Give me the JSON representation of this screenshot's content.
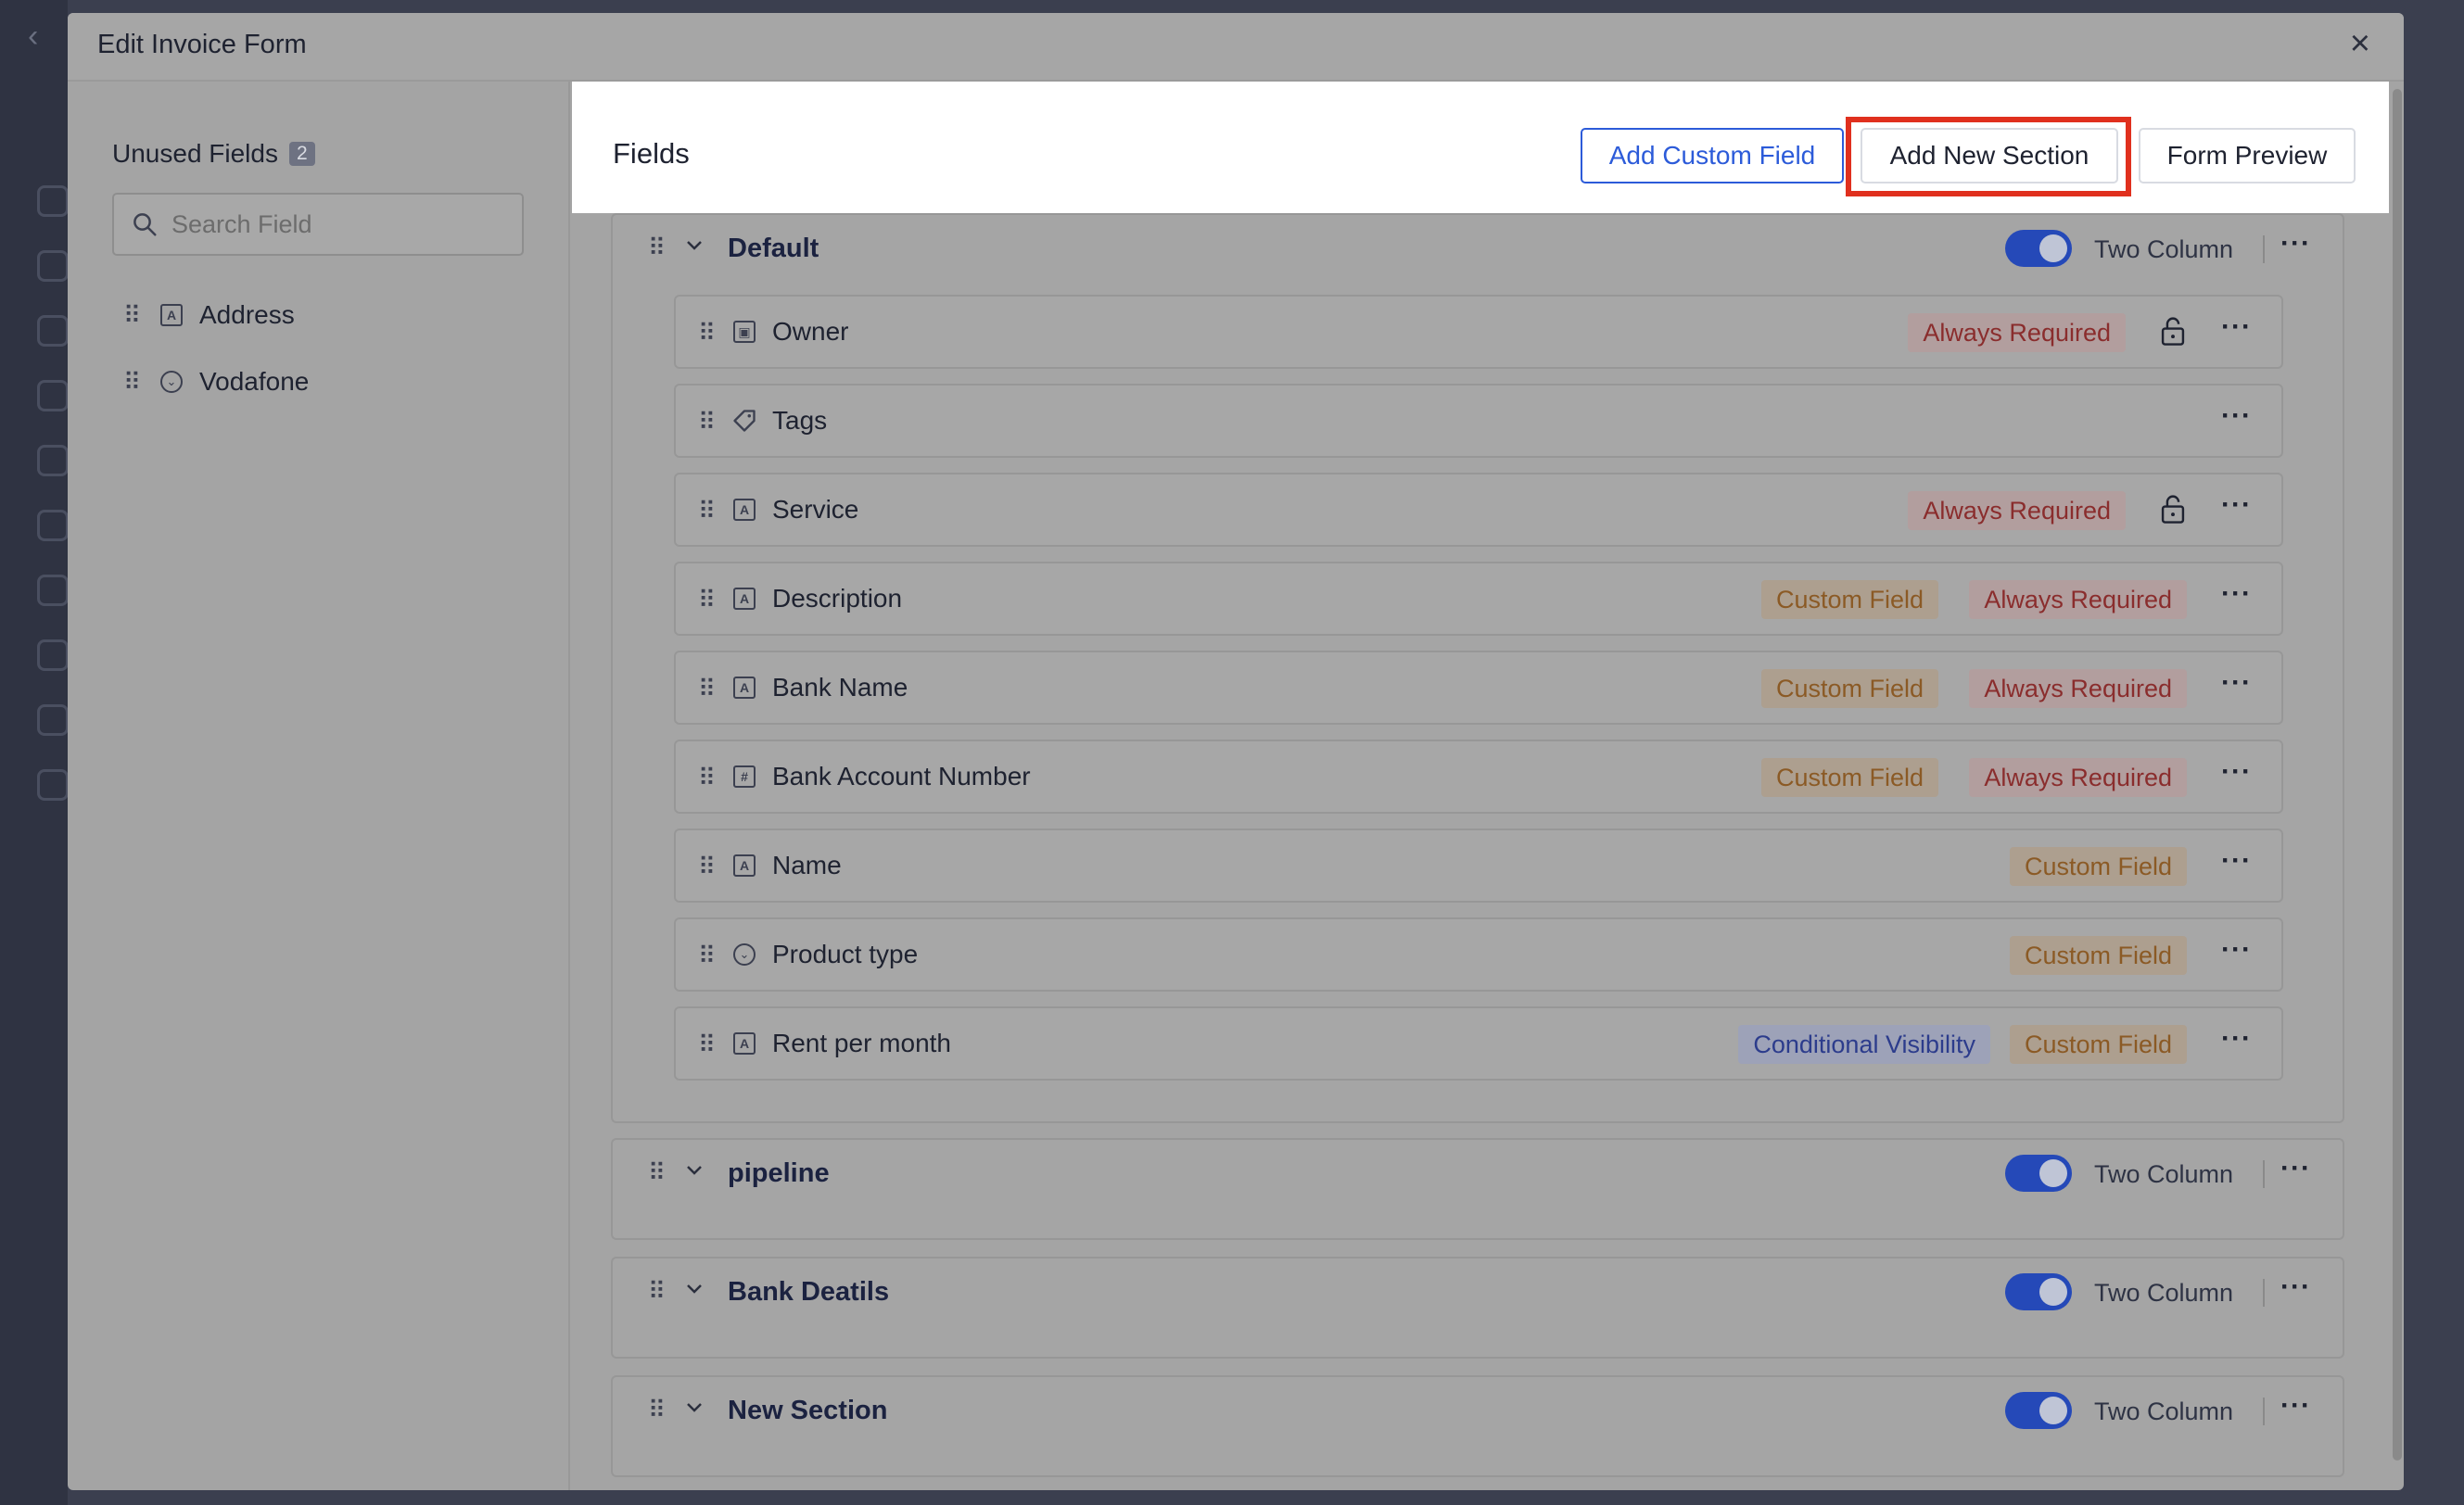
{
  "modal": {
    "title": "Edit Invoice Form",
    "close_icon": "×"
  },
  "unused": {
    "title": "Unused Fields",
    "count": "2",
    "search_placeholder": "Search Field",
    "items": [
      {
        "label": "Address",
        "icon": "text-field-icon"
      },
      {
        "label": "Vodafone",
        "icon": "dropdown-field-icon"
      }
    ]
  },
  "fields_panel": {
    "title": "Fields",
    "add_custom_field": "Add Custom Field",
    "add_new_section": "Add New Section",
    "form_preview": "Form Preview"
  },
  "sections": [
    {
      "title": "Default",
      "toggle_label": "Two Column",
      "toggle_on": true,
      "fields": [
        {
          "label": "Owner",
          "icon": "user-field-icon",
          "badges": [
            "Always Required"
          ],
          "locked": true
        },
        {
          "label": "Tags",
          "icon": "tag-icon",
          "badges": [],
          "locked": false
        },
        {
          "label": "Service",
          "icon": "text-field-icon",
          "badges": [
            "Always Required"
          ],
          "locked": true
        },
        {
          "label": "Description",
          "icon": "text-field-icon",
          "badges": [
            "Custom Field",
            "Always Required"
          ],
          "locked": false
        },
        {
          "label": "Bank Name",
          "icon": "text-field-icon",
          "badges": [
            "Custom Field",
            "Always Required"
          ],
          "locked": false
        },
        {
          "label": "Bank Account Number",
          "icon": "number-field-icon",
          "badges": [
            "Custom Field",
            "Always Required"
          ],
          "locked": false
        },
        {
          "label": "Name",
          "icon": "text-field-icon",
          "badges": [
            "Custom Field"
          ],
          "locked": false
        },
        {
          "label": "Product type",
          "icon": "dropdown-field-icon",
          "badges": [
            "Custom Field"
          ],
          "locked": false
        },
        {
          "label": "Rent per month",
          "icon": "text-field-icon",
          "badges": [
            "Conditional Visibility",
            "Custom Field"
          ],
          "locked": false
        }
      ]
    },
    {
      "title": "pipeline",
      "toggle_label": "Two Column",
      "toggle_on": true,
      "fields": []
    },
    {
      "title": "Bank Deatils",
      "toggle_label": "Two Column",
      "toggle_on": true,
      "fields": []
    },
    {
      "title": "New Section",
      "toggle_label": "Two Column",
      "toggle_on": true,
      "fields": []
    }
  ],
  "glyphs": {
    "drag": "⠿",
    "chevron": "⌄",
    "more": "···",
    "lock": "🔓",
    "search": "⚲",
    "text_icon": "A",
    "number_icon": "#",
    "user_icon": "▣",
    "dropdown_icon": "⌄",
    "tag_icon": "◇"
  },
  "colors": {
    "accent": "#2c5bd9",
    "highlight": "#e0301e",
    "toggle": "#2549b8"
  }
}
